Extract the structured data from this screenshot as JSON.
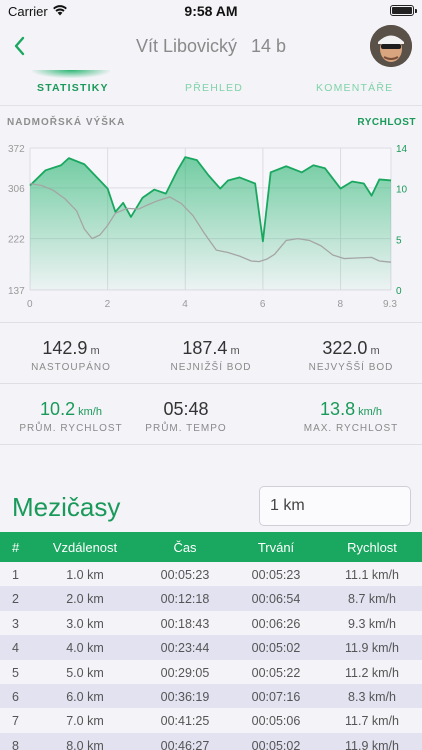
{
  "status_bar": {
    "carrier": "Carrier",
    "time": "9:58 AM"
  },
  "nav": {
    "title": "Vít Libovický",
    "points": "14 b"
  },
  "tabs": [
    {
      "label": "STATISTIKY",
      "active": true
    },
    {
      "label": "PŘEHLED",
      "active": false
    },
    {
      "label": "KOMENTÁŘE",
      "active": false
    }
  ],
  "chart_header": {
    "left_label": "NADMOŘSKÁ VÝŠKA",
    "right_label": "RYCHLOST"
  },
  "chart_data": {
    "type": "area",
    "x_ticks": [
      "0",
      "2",
      "4",
      "6",
      "8",
      "9.3"
    ],
    "y_left_ticks": [
      "372",
      "306",
      "222",
      "137"
    ],
    "y_right_ticks": [
      "14",
      "10",
      "5",
      "0"
    ],
    "y_left_range": [
      137,
      372
    ],
    "y_right_range": [
      0,
      14
    ],
    "x_range": [
      0,
      9.3
    ],
    "series": [
      {
        "axis": "right",
        "color": "#1aa760",
        "x": [
          0,
          0.4,
          0.8,
          1.0,
          1.4,
          1.6,
          2.0,
          2.2,
          2.4,
          2.6,
          2.9,
          3.2,
          3.5,
          3.8,
          4.0,
          4.3,
          4.6,
          4.9,
          5.1,
          5.4,
          5.8,
          6.0,
          6.2,
          6.6,
          7.0,
          7.3,
          7.6,
          8.0,
          8.3,
          8.6,
          8.8,
          9.0,
          9.3
        ],
        "values": [
          10.3,
          11.8,
          12.3,
          13.0,
          12.4,
          11.6,
          10.0,
          7.7,
          8.6,
          7.2,
          9.1,
          9.9,
          9.5,
          11.8,
          13.1,
          12.8,
          11.3,
          10.0,
          10.8,
          11.1,
          10.5,
          4.8,
          11.6,
          12.2,
          11.6,
          12.3,
          12.0,
          10.0,
          10.7,
          10.5,
          9.3,
          10.9,
          10.8
        ]
      },
      {
        "axis": "left",
        "color": "#a5a5a5",
        "x": [
          0,
          0.3,
          0.6,
          0.9,
          1.2,
          1.4,
          1.6,
          1.8,
          2.0,
          2.2,
          2.5,
          2.8,
          3.0,
          3.3,
          3.6,
          3.9,
          4.2,
          4.5,
          4.8,
          5.1,
          5.4,
          5.7,
          5.9,
          6.1,
          6.3,
          6.6,
          6.9,
          7.2,
          7.5,
          7.8,
          8.1,
          8.4,
          8.8,
          9.0,
          9.3
        ],
        "values": [
          313,
          310,
          302,
          288,
          268,
          238,
          222,
          228,
          244,
          264,
          272,
          271,
          277,
          285,
          291,
          280,
          260,
          230,
          203,
          199,
          193,
          185,
          184,
          188,
          196,
          219,
          222,
          219,
          210,
          195,
          189,
          190,
          191,
          185,
          183
        ]
      }
    ]
  },
  "stats": {
    "ascent": {
      "value": "142.9",
      "unit": "m",
      "label": "NASTOUPÁNO"
    },
    "lowest": {
      "value": "187.4",
      "unit": "m",
      "label": "NEJNIŽŠÍ BOD"
    },
    "highest": {
      "value": "322.0",
      "unit": "m",
      "label": "NEJVYŠŠÍ BOD"
    },
    "avg_speed": {
      "value": "10.2",
      "unit": "km/h",
      "label": "PRŮM. RYCHLOST"
    },
    "avg_pace": {
      "value": "05:48",
      "label": "PRŮM. TEMPO"
    },
    "max_speed": {
      "value": "13.8",
      "unit": "km/h",
      "label": "MAX. RYCHLOST"
    }
  },
  "splits": {
    "title": "Mezičasy",
    "interval_value": "1 km",
    "columns": [
      "#",
      "Vzdálenost",
      "Čas",
      "Trvání",
      "Rychlost"
    ],
    "rows": [
      [
        "1",
        "1.0 km",
        "00:05:23",
        "00:05:23",
        "11.1 km/h"
      ],
      [
        "2",
        "2.0 km",
        "00:12:18",
        "00:06:54",
        "8.7 km/h"
      ],
      [
        "3",
        "3.0 km",
        "00:18:43",
        "00:06:26",
        "9.3 km/h"
      ],
      [
        "4",
        "4.0 km",
        "00:23:44",
        "00:05:02",
        "11.9 km/h"
      ],
      [
        "5",
        "5.0 km",
        "00:29:05",
        "00:05:22",
        "11.2 km/h"
      ],
      [
        "6",
        "6.0 km",
        "00:36:19",
        "00:07:16",
        "8.3 km/h"
      ],
      [
        "7",
        "7.0 km",
        "00:41:25",
        "00:05:06",
        "11.7 km/h"
      ],
      [
        "8",
        "8.0 km",
        "00:46:27",
        "00:05:02",
        "11.9 km/h"
      ]
    ]
  }
}
